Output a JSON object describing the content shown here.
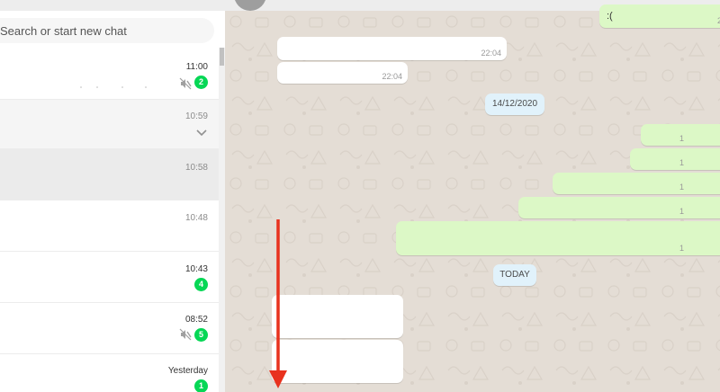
{
  "sidebar": {
    "search_placeholder": "Search or start new chat",
    "chats": [
      {
        "time": "11:00",
        "badge": "2",
        "muted": true
      },
      {
        "time": "10:59",
        "menu_icon": "chevron-down-icon"
      },
      {
        "time": "10:58"
      },
      {
        "time": "10:48"
      },
      {
        "time": "10:43",
        "badge": "4"
      },
      {
        "time": "08:52",
        "badge": "5",
        "muted": true
      },
      {
        "time": "Yesterday",
        "badge": "1"
      }
    ]
  },
  "conversation": {
    "messages_top": [
      {
        "direction": "out",
        "text": ":(",
        "time": "2"
      },
      {
        "direction": "in",
        "time": "22:04"
      },
      {
        "direction": "in",
        "time": "22:04"
      }
    ],
    "date_divider_1": "14/12/2020",
    "outgoing_after_divider": [
      {
        "time": "1"
      },
      {
        "time": "1"
      },
      {
        "time": "1"
      },
      {
        "time": "1"
      },
      {
        "time": "1"
      }
    ],
    "date_divider_2": "TODAY",
    "incoming_today": [
      {
        "direction": "in"
      },
      {
        "direction": "in"
      }
    ]
  },
  "colors": {
    "unread_badge": "#06d755",
    "outgoing_bubble": "#dcf8c6",
    "incoming_bubble": "#ffffff",
    "date_chip": "#e1f2fb",
    "annotation_arrow": "#e8321e"
  },
  "annotation": {
    "type": "arrow",
    "direction": "down"
  }
}
